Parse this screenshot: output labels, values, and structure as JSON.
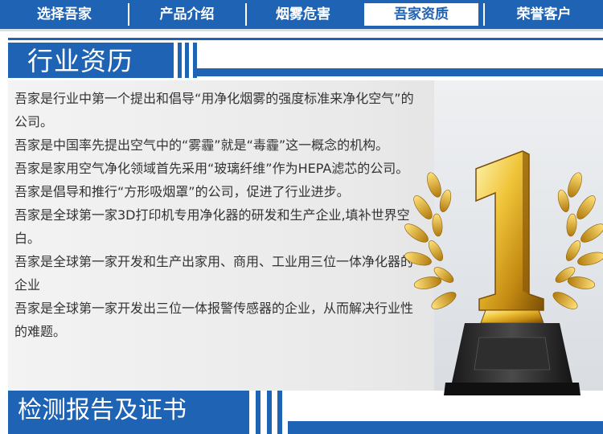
{
  "nav": {
    "items": [
      {
        "label": "选择吾家",
        "active": false
      },
      {
        "label": "产品介绍",
        "active": false
      },
      {
        "label": "烟雾危害",
        "active": false
      },
      {
        "label": "吾家资质",
        "active": true
      },
      {
        "label": "荣誉客户",
        "active": false
      }
    ]
  },
  "section1": {
    "title": "行业资历"
  },
  "facts": [
    "吾家是行业中第一个提出和倡导“用净化烟雾的强度标准来净化空气”的公司。",
    "吾家是中国率先提出空气中的“雾霾”就是“毒霾”这一概念的机构。",
    "吾家是家用空气净化领域首先采用“玻璃纤维”作为HEPA滤芯的公司。",
    "吾家是倡导和推行“方形吸烟罩”的公司，促进了行业进步。",
    "吾家是全球第一家3D打印机专用净化器的研发和生产企业,填补世界空白。",
    "吾家是全球第一家开发和生产出家用、商用、工业用三位一体净化器的企业",
    "吾家是全球第一家开发出三位一体报警传感器的企业，从而解决行业性的难题。"
  ],
  "section2": {
    "title": "检测报告及证书"
  },
  "colors": {
    "brand": "#1f63b4",
    "gold": "#e0b02a",
    "panel": "#ececec"
  },
  "icons": {
    "trophy": "gold-number-one-trophy-icon"
  }
}
